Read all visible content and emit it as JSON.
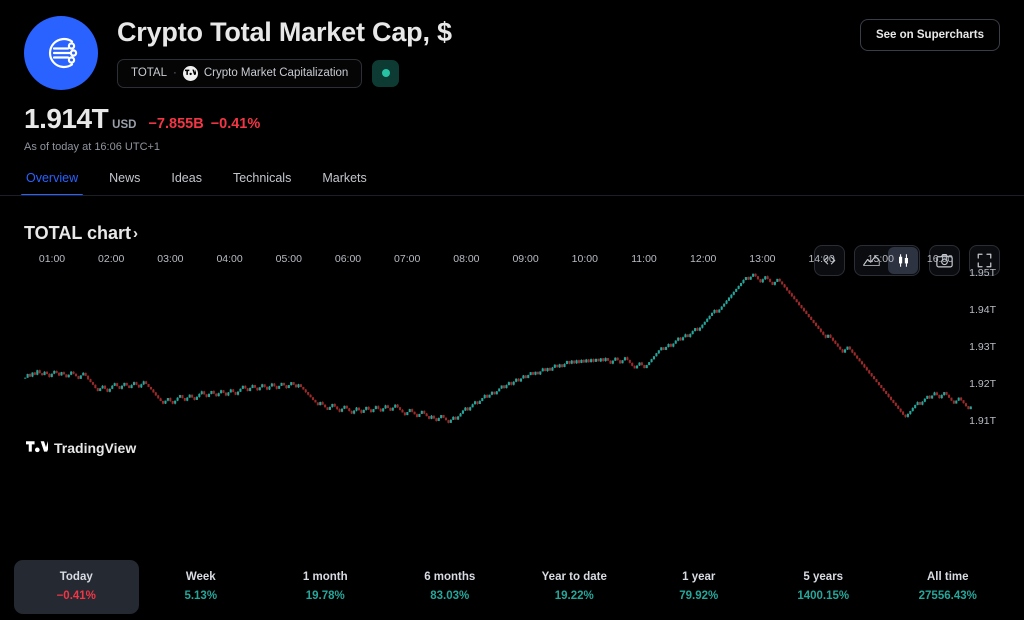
{
  "header": {
    "title": "Crypto Total Market Cap, $",
    "logo_icon": "crypto-network-icon",
    "symbol_ticker": "TOTAL",
    "symbol_separator": "·",
    "symbol_source_icon": "tradingview-logo-icon",
    "symbol_description": "Crypto Market Capitalization",
    "status_dot_color": "#26c2a3",
    "supercharts_label": "See on Supercharts"
  },
  "quote": {
    "value": "1.914T",
    "currency": "USD",
    "change_abs": "−7.855B",
    "change_pct": "−0.41%",
    "change_color": "#f23645",
    "as_of": "As of today at 16:06 UTC+1"
  },
  "tabs": [
    {
      "label": "Overview",
      "active": true
    },
    {
      "label": "News",
      "active": false
    },
    {
      "label": "Ideas",
      "active": false
    },
    {
      "label": "Technicals",
      "active": false
    },
    {
      "label": "Markets",
      "active": false
    }
  ],
  "chart_section": {
    "title": "TOTAL chart",
    "chevron": "›",
    "watermark": "TradingView",
    "toolbar": [
      {
        "name": "embed-code-icon",
        "label": "</>",
        "active": false
      },
      {
        "name": "area-chart-icon",
        "label": "Area",
        "active": false
      },
      {
        "name": "candlestick-chart-icon",
        "label": "Candles",
        "active": true
      },
      {
        "name": "camera-snapshot-icon",
        "label": "Snapshot",
        "active": false
      },
      {
        "name": "fullscreen-icon",
        "label": "Fullscreen",
        "active": false
      }
    ]
  },
  "chart_data": {
    "type": "line",
    "title": "TOTAL chart",
    "xlabel": "",
    "ylabel": "",
    "grid": false,
    "legend_position": "none",
    "y_ticks": [
      "1.91T",
      "1.92T",
      "1.93T",
      "1.94T",
      "1.95T"
    ],
    "y_tick_values": [
      1.91,
      1.92,
      1.93,
      1.94,
      1.95
    ],
    "ylim": [
      1.9055,
      1.9555
    ],
    "x_ticks": [
      "01:00",
      "02:00",
      "03:00",
      "04:00",
      "05:00",
      "06:00",
      "07:00",
      "08:00",
      "09:00",
      "10:00",
      "11:00",
      "12:00",
      "13:00",
      "14:00",
      "15:00",
      "16:00"
    ],
    "xlim": [
      "00:36",
      "16:18"
    ],
    "up_color": "#26a69a",
    "down_color": "#9c2a2a",
    "series": [
      {
        "name": "Crypto Total Market Cap",
        "unit": "T USD",
        "values": [
          1.9218,
          1.9228,
          1.9221,
          1.9232,
          1.9226,
          1.9238,
          1.923,
          1.9225,
          1.9234,
          1.9228,
          1.922,
          1.9229,
          1.9236,
          1.9231,
          1.9224,
          1.9233,
          1.9227,
          1.9219,
          1.9226,
          1.9234,
          1.9229,
          1.9222,
          1.9215,
          1.9224,
          1.9231,
          1.9223,
          1.9214,
          1.9206,
          1.9199,
          1.919,
          1.9182,
          1.9189,
          1.9196,
          1.9188,
          1.918,
          1.9188,
          1.9196,
          1.9203,
          1.9195,
          1.9188,
          1.9196,
          1.9204,
          1.9197,
          1.919,
          1.9198,
          1.9206,
          1.9199,
          1.9192,
          1.92,
          1.9208,
          1.9201,
          1.9193,
          1.9186,
          1.9178,
          1.917,
          1.9162,
          1.9155,
          1.9148,
          1.9156,
          1.9163,
          1.9155,
          1.9148,
          1.9156,
          1.9164,
          1.9171,
          1.9163,
          1.9156,
          1.9164,
          1.9172,
          1.9165,
          1.9158,
          1.9166,
          1.9174,
          1.9181,
          1.9173,
          1.9166,
          1.9174,
          1.9182,
          1.9175,
          1.9168,
          1.9176,
          1.9184,
          1.9177,
          1.917,
          1.9178,
          1.9186,
          1.9179,
          1.9172,
          1.918,
          1.9188,
          1.9196,
          1.9189,
          1.9182,
          1.919,
          1.9198,
          1.9191,
          1.9184,
          1.9192,
          1.92,
          1.9193,
          1.9186,
          1.9194,
          1.9202,
          1.9195,
          1.9188,
          1.9196,
          1.9204,
          1.9197,
          1.919,
          1.9198,
          1.9206,
          1.9199,
          1.9192,
          1.92,
          1.9193,
          1.9186,
          1.9179,
          1.9172,
          1.9165,
          1.9158,
          1.9151,
          1.9144,
          1.9152,
          1.9145,
          1.9138,
          1.9131,
          1.9139,
          1.9147,
          1.914,
          1.9133,
          1.9126,
          1.9134,
          1.9142,
          1.9135,
          1.9128,
          1.9121,
          1.9129,
          1.9137,
          1.913,
          1.9123,
          1.9131,
          1.9139,
          1.9132,
          1.9125,
          1.9133,
          1.9141,
          1.9134,
          1.9127,
          1.9135,
          1.9143,
          1.9136,
          1.9129,
          1.9137,
          1.9145,
          1.9138,
          1.9131,
          1.9124,
          1.9117,
          1.9125,
          1.9133,
          1.9126,
          1.9119,
          1.9112,
          1.912,
          1.9128,
          1.9121,
          1.9114,
          1.9107,
          1.9115,
          1.9108,
          1.9101,
          1.9109,
          1.9117,
          1.911,
          1.9103,
          1.9096,
          1.9104,
          1.9112,
          1.9105,
          1.9113,
          1.9121,
          1.9129,
          1.9137,
          1.913,
          1.9138,
          1.9146,
          1.9154,
          1.9147,
          1.9155,
          1.9163,
          1.9171,
          1.9164,
          1.9172,
          1.918,
          1.9173,
          1.9181,
          1.9189,
          1.9197,
          1.919,
          1.9198,
          1.9206,
          1.9199,
          1.9207,
          1.9215,
          1.9208,
          1.9216,
          1.9224,
          1.9217,
          1.9225,
          1.9233,
          1.9226,
          1.9234,
          1.9227,
          1.9235,
          1.9243,
          1.9236,
          1.9244,
          1.9237,
          1.9245,
          1.9253,
          1.9246,
          1.9254,
          1.9247,
          1.9255,
          1.9263,
          1.9256,
          1.9264,
          1.9257,
          1.9265,
          1.9258,
          1.9266,
          1.9259,
          1.9267,
          1.926,
          1.9268,
          1.9261,
          1.9269,
          1.9262,
          1.927,
          1.9263,
          1.9271,
          1.9264,
          1.9256,
          1.9264,
          1.9272,
          1.9265,
          1.9257,
          1.9265,
          1.9273,
          1.9266,
          1.9258,
          1.925,
          1.9243,
          1.9251,
          1.9259,
          1.9252,
          1.9244,
          1.9252,
          1.926,
          1.9268,
          1.9276,
          1.9284,
          1.9292,
          1.93,
          1.9293,
          1.9301,
          1.9309,
          1.9302,
          1.931,
          1.9318,
          1.9326,
          1.9319,
          1.9327,
          1.9335,
          1.9328,
          1.9336,
          1.9344,
          1.9352,
          1.9345,
          1.9353,
          1.9361,
          1.9369,
          1.9377,
          1.9385,
          1.9393,
          1.9401,
          1.9394,
          1.9402,
          1.941,
          1.9418,
          1.9426,
          1.9434,
          1.9442,
          1.945,
          1.9458,
          1.9466,
          1.9474,
          1.9482,
          1.949,
          1.9483,
          1.9491,
          1.9499,
          1.9492,
          1.9484,
          1.9476,
          1.9484,
          1.9492,
          1.9485,
          1.9477,
          1.9469,
          1.9477,
          1.9485,
          1.9478,
          1.947,
          1.9462,
          1.9454,
          1.9446,
          1.9438,
          1.943,
          1.9422,
          1.9414,
          1.9406,
          1.9398,
          1.939,
          1.9382,
          1.9374,
          1.9366,
          1.9358,
          1.935,
          1.9342,
          1.9334,
          1.9326,
          1.9334,
          1.9326,
          1.9318,
          1.931,
          1.9302,
          1.9294,
          1.9286,
          1.9294,
          1.9302,
          1.9294,
          1.9286,
          1.9278,
          1.927,
          1.9262,
          1.9254,
          1.9246,
          1.9238,
          1.923,
          1.9222,
          1.9214,
          1.9206,
          1.9198,
          1.919,
          1.9182,
          1.9174,
          1.9166,
          1.9158,
          1.915,
          1.9142,
          1.9134,
          1.9126,
          1.9118,
          1.9112,
          1.912,
          1.9128,
          1.9136,
          1.9144,
          1.9152,
          1.9145,
          1.9153,
          1.9161,
          1.9169,
          1.9162,
          1.917,
          1.9178,
          1.9171,
          1.9163,
          1.9171,
          1.9179,
          1.9172,
          1.9164,
          1.9156,
          1.9148,
          1.9156,
          1.9164,
          1.9157,
          1.9149,
          1.9141,
          1.9133,
          1.914
        ]
      }
    ]
  },
  "performance": [
    {
      "label": "Today",
      "value": "−0.41%",
      "positive": false,
      "active": true
    },
    {
      "label": "Week",
      "value": "5.13%",
      "positive": true,
      "active": false
    },
    {
      "label": "1 month",
      "value": "19.78%",
      "positive": true,
      "active": false
    },
    {
      "label": "6 months",
      "value": "83.03%",
      "positive": true,
      "active": false
    },
    {
      "label": "Year to date",
      "value": "19.22%",
      "positive": true,
      "active": false
    },
    {
      "label": "1 year",
      "value": "79.92%",
      "positive": true,
      "active": false
    },
    {
      "label": "5 years",
      "value": "1400.15%",
      "positive": true,
      "active": false
    },
    {
      "label": "All time",
      "value": "27556.43%",
      "positive": true,
      "active": false
    }
  ]
}
